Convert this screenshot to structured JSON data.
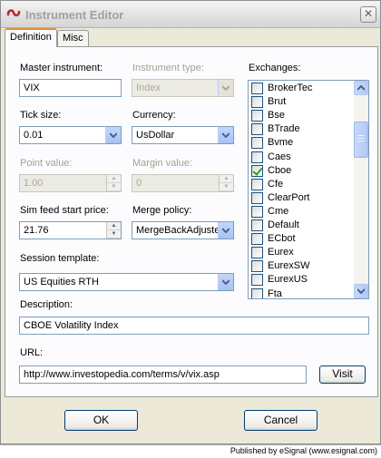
{
  "window": {
    "title": "Instrument Editor",
    "close_glyph": "✕"
  },
  "tabs": [
    {
      "label": "Definition"
    },
    {
      "label": "Misc"
    }
  ],
  "form": {
    "master_instrument": {
      "label": "Master instrument:",
      "value": "VIX"
    },
    "instrument_type": {
      "label": "Instrument type:",
      "value": "Index"
    },
    "tick_size": {
      "label": "Tick size:",
      "value": "0.01"
    },
    "currency": {
      "label": "Currency:",
      "value": "UsDollar"
    },
    "point_value": {
      "label": "Point value:",
      "value": "1.00"
    },
    "margin_value": {
      "label": "Margin value:",
      "value": "0"
    },
    "sim_feed_start_price": {
      "label": "Sim feed start price:",
      "value": "21.76"
    },
    "merge_policy": {
      "label": "Merge policy:",
      "value": "MergeBackAdjusted"
    },
    "session_template": {
      "label": "Session template:",
      "value": "US Equities RTH"
    },
    "description": {
      "label": "Description:",
      "value": "CBOE Volatility Index"
    },
    "url": {
      "label": "URL:",
      "value": "http://www.investopedia.com/terms/v/vix.asp"
    },
    "visit_label": "Visit"
  },
  "exchanges": {
    "label": "Exchanges:",
    "items": [
      {
        "name": "BrokerTec",
        "checked": false
      },
      {
        "name": "Brut",
        "checked": false
      },
      {
        "name": "Bse",
        "checked": false
      },
      {
        "name": "BTrade",
        "checked": false
      },
      {
        "name": "Bvme",
        "checked": false
      },
      {
        "name": "Caes",
        "checked": false
      },
      {
        "name": "Cboe",
        "checked": true
      },
      {
        "name": "Cfe",
        "checked": false
      },
      {
        "name": "ClearPort",
        "checked": false
      },
      {
        "name": "Cme",
        "checked": false
      },
      {
        "name": "Default",
        "checked": false
      },
      {
        "name": "ECbot",
        "checked": false
      },
      {
        "name": "Eurex",
        "checked": false
      },
      {
        "name": "EurexSW",
        "checked": false
      },
      {
        "name": "EurexUS",
        "checked": false
      },
      {
        "name": "Fta",
        "checked": false
      }
    ]
  },
  "buttons": {
    "ok": "OK",
    "cancel": "Cancel"
  },
  "status": {
    "text": "Published by eSignal (www.esignal.com)"
  },
  "colors": {
    "tab_highlight": "#e68b2c",
    "field_border": "#7f9db9",
    "check_mark": "#21a121",
    "app_icon": "#c0282d"
  },
  "icons": {
    "app": "esignal-logo-icon",
    "dropdown": "chevron-down-icon",
    "scroll_up": "arrow-up-icon",
    "scroll_down": "arrow-down-icon"
  }
}
